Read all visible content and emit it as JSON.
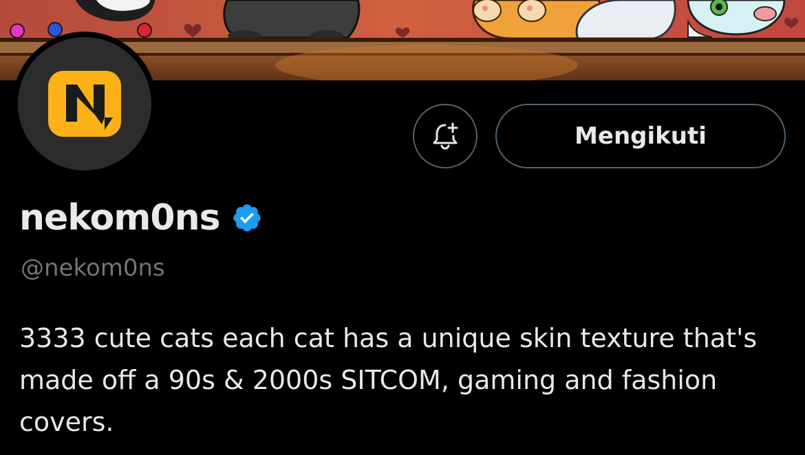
{
  "profile": {
    "display_name": "nekom0ns",
    "handle": "@nekom0ns",
    "verified": true,
    "bio": "3333 cute cats each cat has a unique skin texture that's made off a 90s & 2000s SITCOM, gaming and fashion covers.",
    "avatar_letter": "N"
  },
  "actions": {
    "notify_icon": "bell-plus-icon",
    "follow_label": "Mengikuti"
  },
  "colors": {
    "background": "#000000",
    "text_primary": "#e7e9ea",
    "text_secondary": "#71767b",
    "border": "#536471",
    "verified_blue": "#1d9bf0",
    "avatar_logo_yellow": "#fbb117"
  }
}
